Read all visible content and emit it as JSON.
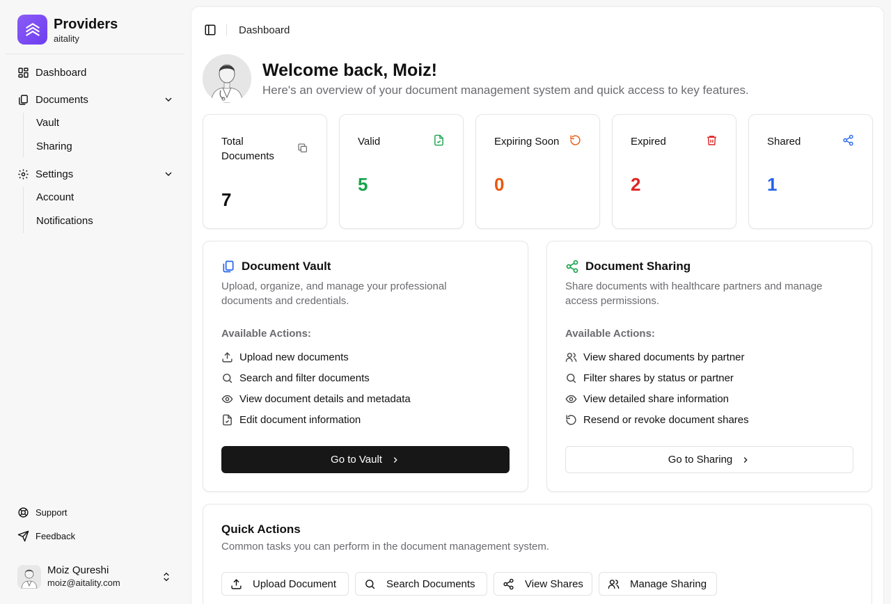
{
  "brand": {
    "name": "Providers",
    "sub": "aitality"
  },
  "sidebar": {
    "items": [
      {
        "label": "Dashboard"
      },
      {
        "label": "Documents",
        "children": [
          "Vault",
          "Sharing"
        ]
      },
      {
        "label": "Settings",
        "children": [
          "Account",
          "Notifications"
        ]
      }
    ],
    "footer": [
      "Support",
      "Feedback"
    ]
  },
  "user": {
    "name": "Moiz Qureshi",
    "email": "moiz@aitality.com"
  },
  "breadcrumb": "Dashboard",
  "welcome": {
    "title": "Welcome back, Moiz!",
    "subtitle": "Here's an overview of your document management system and quick access to key features."
  },
  "stats": [
    {
      "label": "Total Documents",
      "value": "7",
      "color": "#111111",
      "icon": "copy-icon"
    },
    {
      "label": "Valid",
      "value": "5",
      "color": "#16a34a",
      "icon": "file-check-icon"
    },
    {
      "label": "Expiring Soon",
      "value": "0",
      "color": "#ea580c",
      "icon": "rotate-icon"
    },
    {
      "label": "Expired",
      "value": "2",
      "color": "#dc2626",
      "icon": "trash-icon"
    },
    {
      "label": "Shared",
      "value": "1",
      "color": "#2563eb",
      "icon": "share-icon"
    }
  ],
  "vault": {
    "title": "Document Vault",
    "description": "Upload, organize, and manage your professional documents and credentials.",
    "actions_label": "Available Actions:",
    "actions": [
      "Upload new documents",
      "Search and filter documents",
      "View document details and metadata",
      "Edit document information"
    ],
    "button": "Go to Vault"
  },
  "sharing": {
    "title": "Document Sharing",
    "description": "Share documents with healthcare partners and manage access permissions.",
    "actions_label": "Available Actions:",
    "actions": [
      "View shared documents by partner",
      "Filter shares by status or partner",
      "View detailed share information",
      "Resend or revoke document shares"
    ],
    "button": "Go to Sharing"
  },
  "quick": {
    "title": "Quick Actions",
    "description": "Common tasks you can perform in the document management system.",
    "buttons": [
      "Upload Document",
      "Search Documents",
      "View Shares",
      "Manage Sharing"
    ]
  },
  "colors": {
    "accent": "#7c4dff",
    "valid": "#16a34a",
    "expiring": "#ea580c",
    "expired": "#dc2626",
    "shared": "#2563eb",
    "vault_icon": "#2563eb",
    "sharing_icon": "#16a34a"
  }
}
